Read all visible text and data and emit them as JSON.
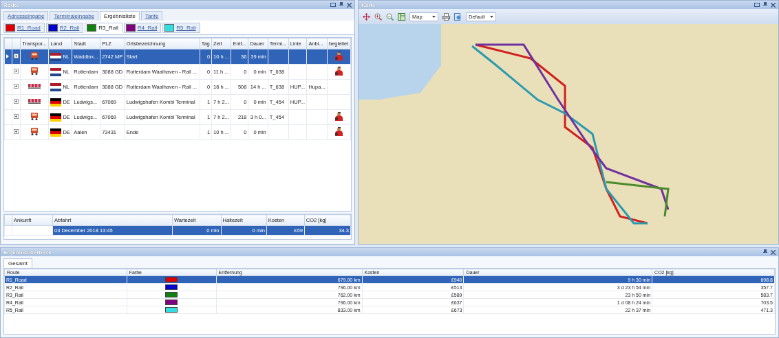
{
  "route_panel": {
    "title": "Route",
    "tabs": [
      {
        "label": "Adresseingabe",
        "selected": false
      },
      {
        "label": "Terminaleingabe",
        "selected": false
      },
      {
        "label": "Ergebnisliste",
        "selected": true
      },
      {
        "label": "Tarife",
        "selected": false
      }
    ],
    "route_tabs": [
      {
        "label": "R1_Road",
        "color": "#e00000",
        "selected": false
      },
      {
        "label": "R2_Rail",
        "color": "#0000d0",
        "selected": false
      },
      {
        "label": "R3_Rail",
        "color": "#108010",
        "selected": true
      },
      {
        "label": "R4_Rail",
        "color": "#800080",
        "selected": false
      },
      {
        "label": "R5_Rail",
        "color": "#30e0e0",
        "selected": false
      }
    ],
    "columns": [
      "Transpor...",
      "Land",
      "Stadt",
      "PLZ",
      "Ortsbezeichnung",
      "Tag",
      "Zeit",
      "Entf...",
      "Dauer",
      "Termi...",
      "Linie",
      "Anbi...",
      "begleitet"
    ],
    "stops": [
      {
        "kind": "road",
        "flag": {
          "kind": "nl"
        },
        "land": "NL",
        "stadt": "Waddinx...",
        "plz": "2742 MP",
        "ort": "Start",
        "tag": "0",
        "zeit": "10 h ...",
        "entf": "36",
        "dauer": "39 min",
        "escorted": true,
        "selected": true
      },
      {
        "kind": "road",
        "flag": {
          "kind": "nl"
        },
        "land": "NL",
        "stadt": "Rotterdam",
        "plz": "3088 GD",
        "ort": "Rotterdam Waalhaven - Rail ...",
        "tag": "0",
        "zeit": "11 h ...",
        "entf": "0",
        "dauer": "0 min",
        "terminal": "T_638",
        "escorted": true,
        "selected": false
      },
      {
        "kind": "rail",
        "flag": {
          "kind": "nl"
        },
        "land": "NL",
        "stadt": "Rotterdam",
        "plz": "3088 GD",
        "ort": "Rotterdam Waalhaven - Rail ...",
        "tag": "0",
        "zeit": "16 h ...",
        "entf": "508",
        "dauer": "14 h ...",
        "terminal": "T_638",
        "linie": "HUP...",
        "anbieter": "Hupa...",
        "escorted": false,
        "selected": false
      },
      {
        "kind": "rail",
        "flag": {
          "kind": "de"
        },
        "land": "DE",
        "stadt": "Ludwigs...",
        "plz": "67069",
        "ort": "Ludwigshafen Kombi Terminal",
        "tag": "1",
        "zeit": "7 h 2...",
        "entf": "0",
        "dauer": "0 min",
        "terminal": "T_454",
        "linie": "HUP...",
        "escorted": false,
        "selected": false
      },
      {
        "kind": "road",
        "flag": {
          "kind": "de"
        },
        "land": "DE",
        "stadt": "Ludwigs...",
        "plz": "67069",
        "ort": "Ludwigshafen Kombi Terminal",
        "tag": "1",
        "zeit": "7 h 2...",
        "entf": "218",
        "dauer": "3 h 0...",
        "terminal": "T_454",
        "escorted": true,
        "selected": false
      },
      {
        "kind": "road",
        "flag": {
          "kind": "de"
        },
        "land": "DE",
        "stadt": "Aalen",
        "plz": "73431",
        "ort": "Ende",
        "tag": "1",
        "zeit": "10 h ...",
        "entf": "0",
        "dauer": "0 min",
        "escorted": true,
        "selected": false
      }
    ],
    "detail_columns": [
      "Ankunft",
      "Abfahrt",
      "Wartezeit",
      "Haltezeit",
      "Kosten",
      "CO2 [kg]"
    ],
    "detail_row": {
      "selected": true,
      "abfahrt": "03 December 2018 13:45",
      "wartezeit": "0 min",
      "haltezeit": "0 min",
      "kosten": "£59",
      "co2": "34.3"
    }
  },
  "map_panel": {
    "title": "Karte",
    "map_type": "Map",
    "style": "Default"
  },
  "summary_panel": {
    "title": "Ergebnisüberblick",
    "tab": "Gesamt",
    "columns": [
      "Route",
      "Farbe",
      "Entfernung",
      "Kosten",
      "Dauer",
      "CO2 [kg]"
    ],
    "rows": [
      {
        "route": "R1_Road",
        "color": "#e00000",
        "distance": "679.00 km",
        "cost": "£940",
        "duration": "9 h 30 min",
        "co2": "698.8",
        "selected": true
      },
      {
        "route": "R2_Rail",
        "color": "#0000d0",
        "distance": "796.00 km",
        "cost": "£513",
        "duration": "3 d 23 h 54 min",
        "co2": "357.7",
        "selected": false
      },
      {
        "route": "R3_Rail",
        "color": "#108010",
        "distance": "762.00 km",
        "cost": "£589",
        "duration": "23 h 50 min",
        "co2": "583.7",
        "selected": false
      },
      {
        "route": "R4_Rail",
        "color": "#800080",
        "distance": "796.00 km",
        "cost": "£637",
        "duration": "1 d 08 h 24 min",
        "co2": "703.5",
        "selected": false
      },
      {
        "route": "R5_Rail",
        "color": "#30e0e0",
        "distance": "833.00 km",
        "cost": "£673",
        "duration": "22 h 37 min",
        "co2": "471.3",
        "selected": false
      }
    ]
  }
}
